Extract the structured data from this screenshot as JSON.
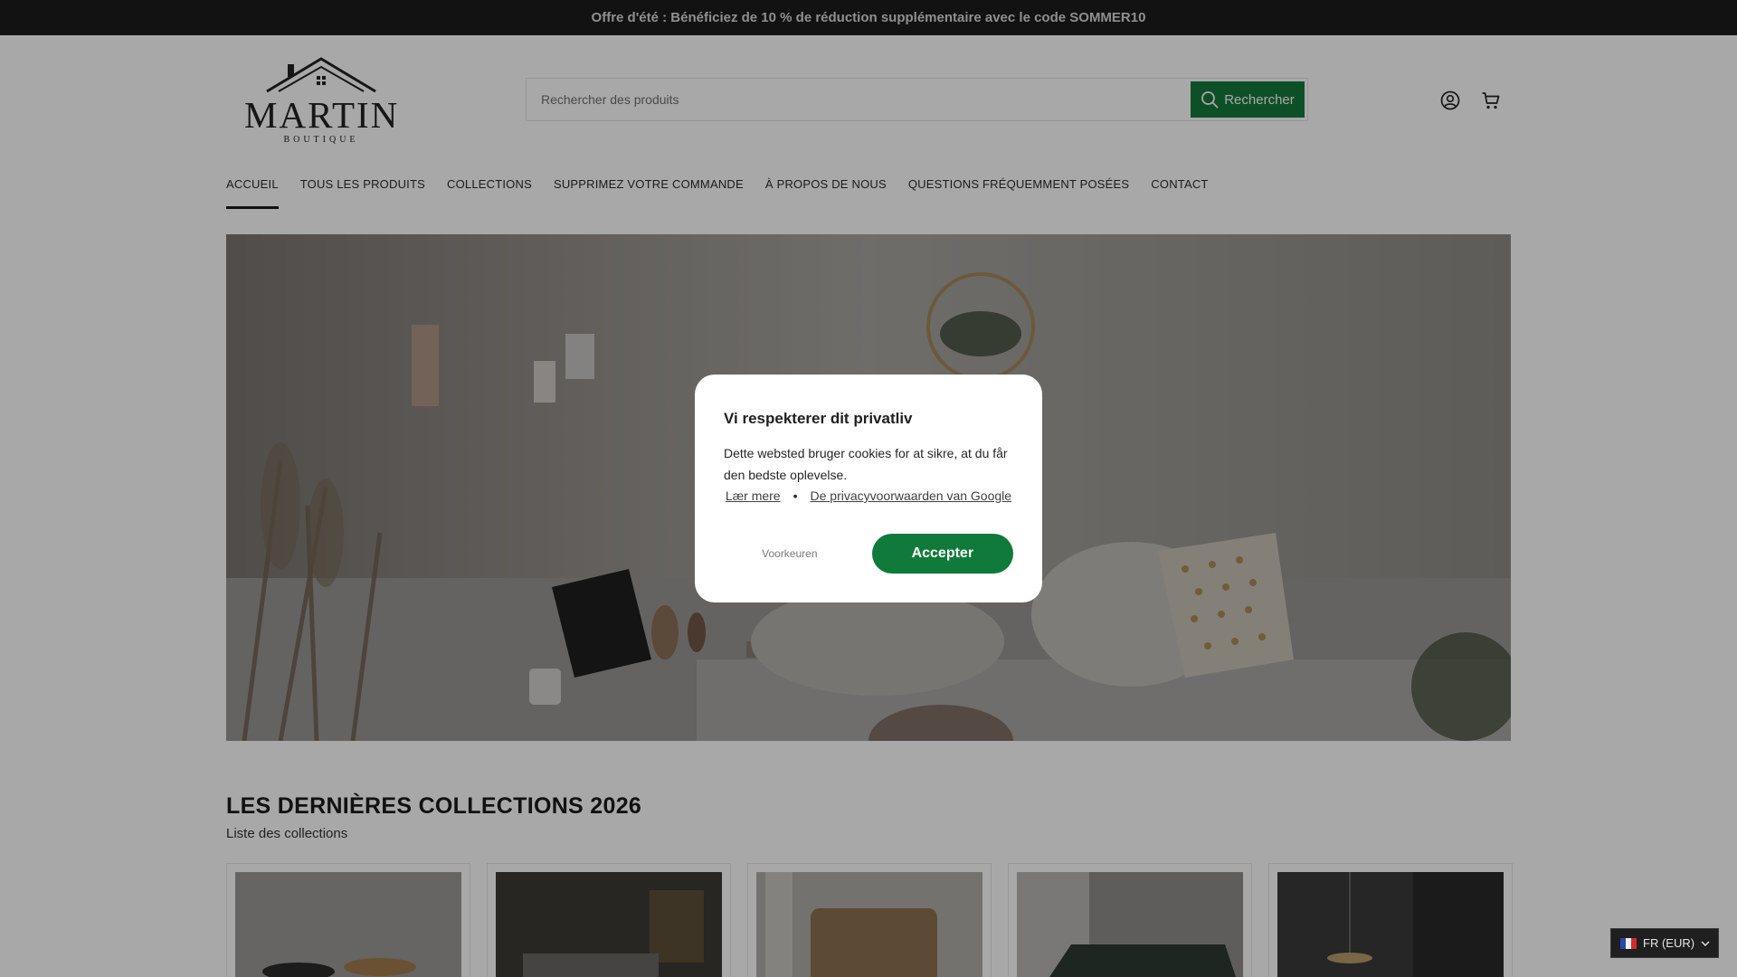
{
  "announcement": {
    "text": "Offre d'été : Bénéficiez de 10 % de réduction supplémentaire avec le code SOMMER10"
  },
  "header": {
    "logo_text": "MARTIN",
    "logo_subtext": "BOUTIQUE",
    "search_placeholder": "Rechercher des produits",
    "search_value": "",
    "search_button": "Rechercher",
    "icons": [
      "search-icon",
      "account-icon",
      "cart-icon"
    ]
  },
  "nav": {
    "items": [
      {
        "label": "ACCUEIL",
        "active": true
      },
      {
        "label": "TOUS LES PRODUITS",
        "active": false
      },
      {
        "label": "COLLECTIONS",
        "active": false
      },
      {
        "label": "SUPPRIMEZ VOTRE COMMANDE",
        "active": false
      },
      {
        "label": "À PROPOS DE NOUS",
        "active": false
      },
      {
        "label": "QUESTIONS FRÉQUEMMENT POSÉES",
        "active": false
      },
      {
        "label": "CONTACT",
        "active": false
      }
    ]
  },
  "collections": {
    "title": "LES DERNIÈRES COLLECTIONS 2026",
    "subtitle": "Liste des collections",
    "card_count": 5
  },
  "cookie_modal": {
    "title": "Vi respekterer dit privatliv",
    "body": "Dette websted bruger cookies for at sikre, at du får den bedste oplevelse.",
    "link_learn": "Lær mere",
    "link_separator": "•",
    "link_google": "De privacyvoorwaarden van Google",
    "preferences_button": "Voorkeuren",
    "accept_button": "Accepter"
  },
  "currency": {
    "label": "FR (EUR)",
    "flag": "france-flag-icon"
  },
  "colors": {
    "accent_green": "#157a3c",
    "announcement_bg": "#1c1c1c",
    "overlay": "rgba(0,0,0,0.34)"
  }
}
